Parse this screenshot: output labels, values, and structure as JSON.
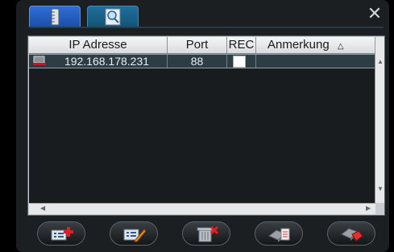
{
  "window": {
    "close_glyph": "✕"
  },
  "tabs": [
    {
      "icon": "ruler-icon"
    },
    {
      "icon": "magnifier-icon"
    }
  ],
  "table": {
    "columns": [
      "IP Adresse",
      "Port",
      "REC",
      "Anmerkung"
    ],
    "sort_glyph": "△",
    "rows": [
      {
        "icon": "device-icon",
        "ip": "192.168.178.231",
        "port": "88",
        "rec": false,
        "note": ""
      }
    ]
  },
  "toolbar": {
    "buttons": [
      {
        "icon": "add-device-icon"
      },
      {
        "icon": "edit-device-icon"
      },
      {
        "icon": "delete-device-icon"
      },
      {
        "icon": "connect-icon"
      },
      {
        "icon": "disconnect-icon"
      }
    ]
  }
}
